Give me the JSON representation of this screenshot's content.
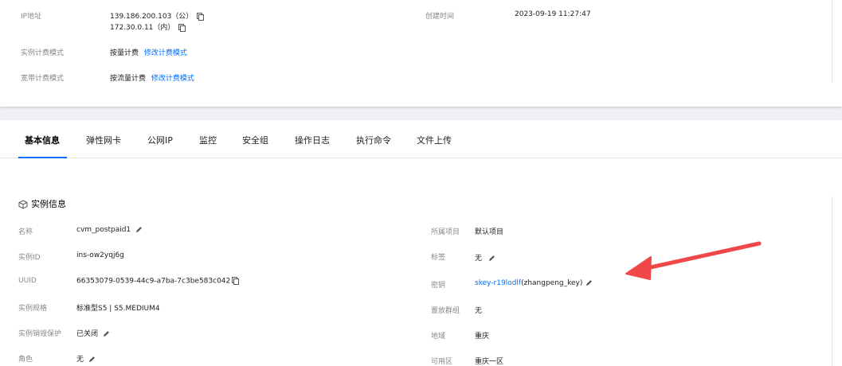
{
  "top": {
    "ip_label": "IP地址",
    "ip_public": "139.186.200.103（公）",
    "ip_private": "172.30.0.11（内）",
    "created_label": "创建时间",
    "created_value": "2023-09-19 11:27:47",
    "instance_billing_label": "实例计费模式",
    "instance_billing_value": "按量计费",
    "instance_billing_link": "修改计费模式",
    "bandwidth_billing_label": "宽带计费模式",
    "bandwidth_billing_value": "按流量计费",
    "bandwidth_billing_link": "修改计费模式"
  },
  "tabs": [
    "基本信息",
    "弹性网卡",
    "公网IP",
    "监控",
    "安全组",
    "操作日志",
    "执行命令",
    "文件上传"
  ],
  "section": {
    "title": "实例信息"
  },
  "left": {
    "name_label": "名称",
    "name_value": "cvm_postpaid1",
    "id_label": "实例ID",
    "id_value": "ins-ow2yqj6g",
    "uuid_label": "UUID",
    "uuid_value": "66353079-0539-44c9-a7ba-7c3be583c042",
    "spec_label": "实例规格",
    "spec_value": "标准型S5 | S5.MEDIUM4",
    "protect_label": "实例销毁保护",
    "protect_value": "已关闭",
    "role_label": "角色",
    "role_value": "无"
  },
  "right": {
    "project_label": "所属项目",
    "project_value": "默认项目",
    "tag_label": "标签",
    "tag_value": "无",
    "key_label": "密钥",
    "key_link": "skey-r19lodlf",
    "key_suffix": "(zhangpeng_key)",
    "group_label": "置放群组",
    "group_value": "无",
    "region_label": "地域",
    "region_value": "重庆",
    "zone_label": "可用区",
    "zone_value": "重庆一区"
  },
  "colors": {
    "accent": "#006eff",
    "arrow": "#f04848"
  }
}
